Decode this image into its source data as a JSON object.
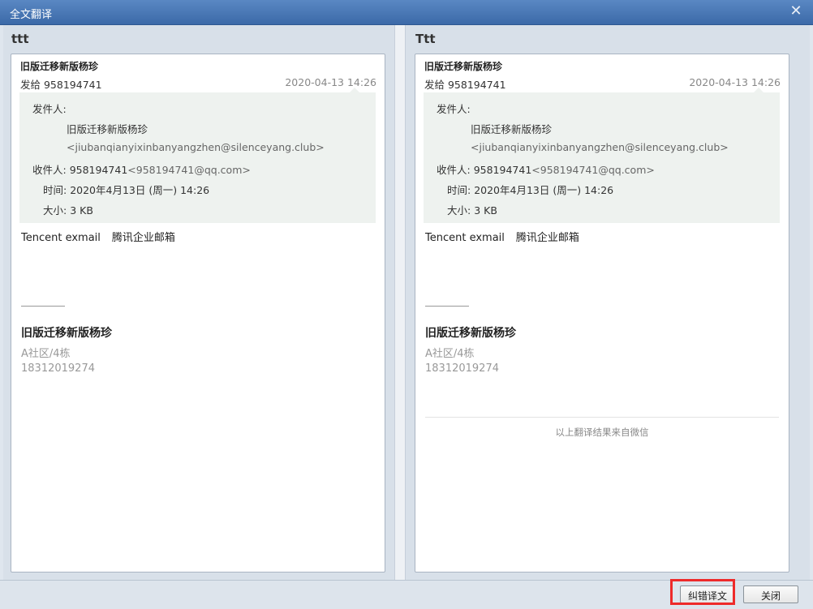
{
  "window": {
    "title": "全文翻译",
    "close_glyph": "✕"
  },
  "panes": [
    {
      "title": "ttt",
      "subject": "旧版迁移新版杨珍",
      "to_label": "发给 958194741",
      "date": "2020-04-13 14:26",
      "sender_label": "发件人:",
      "sender_name": "旧版迁移新版杨珍",
      "sender_email": "<jiubanqianyixinbanyangzhen@silenceyang.club>",
      "recipient_label": "收件人:",
      "recipient_name": "958194741",
      "recipient_email": "<958194741@qq.com>",
      "time_label": "时间:",
      "time_value": "2020年4月13日 (周一) 14:26",
      "size_label": "大小:",
      "size_value": "3 KB",
      "body_part1": "Tencent exmail",
      "body_part2": "腾讯企业邮箱",
      "sig_name": "旧版迁移新版杨珍",
      "sig_address": "A社区/4栋",
      "sig_phone": "18312019274"
    },
    {
      "title": "Ttt",
      "subject": "旧版迁移新版杨珍",
      "to_label": "发给 958194741",
      "date": "2020-04-13 14:26",
      "sender_label": "发件人:",
      "sender_name": "旧版迁移新版杨珍",
      "sender_email": "<jiubanqianyixinbanyangzhen@silenceyang.club>",
      "recipient_label": "收件人:",
      "recipient_name": "958194741",
      "recipient_email": "<958194741@qq.com>",
      "time_label": "时间:",
      "time_value": "2020年4月13日 (周一) 14:26",
      "size_label": "大小:",
      "size_value": "3 KB",
      "body_part1": "Tencent exmail",
      "body_part2": "腾讯企业邮箱",
      "sig_name": "旧版迁移新版杨珍",
      "sig_address": "A社区/4栋",
      "sig_phone": "18312019274",
      "footer_note": "以上翻译结果来自微信"
    }
  ],
  "buttons": {
    "correct": "纠错译文",
    "close": "关闭"
  },
  "colors": {
    "titlebar": "#3c6aa8",
    "highlight": "#ee2a2a"
  }
}
